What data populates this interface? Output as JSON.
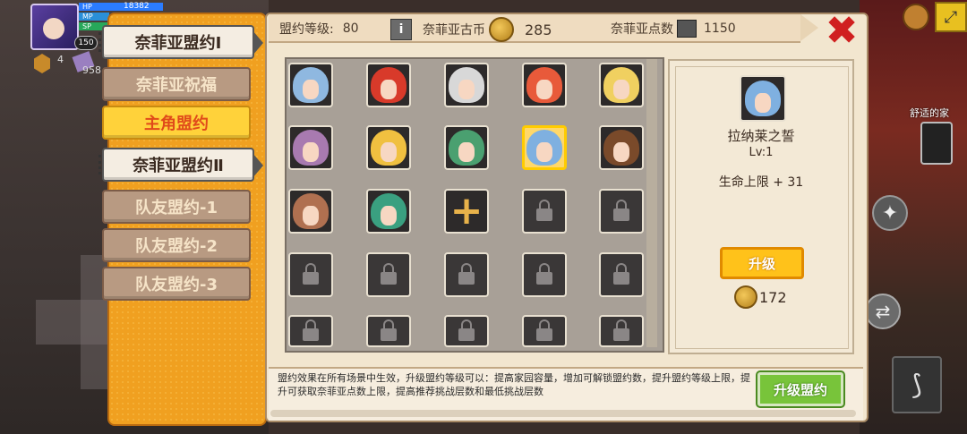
{
  "hud": {
    "hp_label": "HP",
    "hp_value": "18382",
    "mp_label": "MP",
    "sp_label": "SP",
    "level": "150",
    "count_left": "4",
    "count_right": "958"
  },
  "tabs": [
    {
      "label": "奈菲亚盟约Ⅰ",
      "style": "white"
    },
    {
      "label": "奈菲亚祝福",
      "style": "plain"
    },
    {
      "label": "主角盟约",
      "style": "active"
    },
    {
      "label": "奈菲亚盟约Ⅱ",
      "style": "white"
    },
    {
      "label": "队友盟约-1",
      "style": "plain"
    },
    {
      "label": "队友盟约-2",
      "style": "plain"
    },
    {
      "label": "队友盟约-3",
      "style": "plain"
    }
  ],
  "topbar": {
    "level_label": "盟约等级:",
    "level_value": "80",
    "coin_label": "奈菲亚古币",
    "coin_value": "285",
    "points_label": "奈菲亚点数",
    "points_value": "1150"
  },
  "grid": {
    "portrait_colors": [
      "#8fb8e0",
      "#d83a2a",
      "#d8d8d8",
      "#e85a3a",
      "#f0d060",
      "#a87ab0",
      "#f0c040",
      "#4aa070",
      "#7fb0e0",
      "#7a4a2a",
      "#b07050",
      "#3aa080"
    ],
    "plus_slot": "+"
  },
  "detail": {
    "name": "拉纳莱之誓",
    "level": "Lv:1",
    "stat": "生命上限 + 31",
    "upgrade_label": "升级",
    "cost": "172"
  },
  "description": {
    "text": "盟约效果在所有场景中生效，升级盟约等级可以：提高家园容量，增加可解锁盟约数，提升盟约等级上限，提升可获取奈菲亚点数上限，提高推荐挑战层数和最低挑战层数",
    "button_label": "升级盟约"
  },
  "right_hud": {
    "home_label": "舒适的家"
  }
}
